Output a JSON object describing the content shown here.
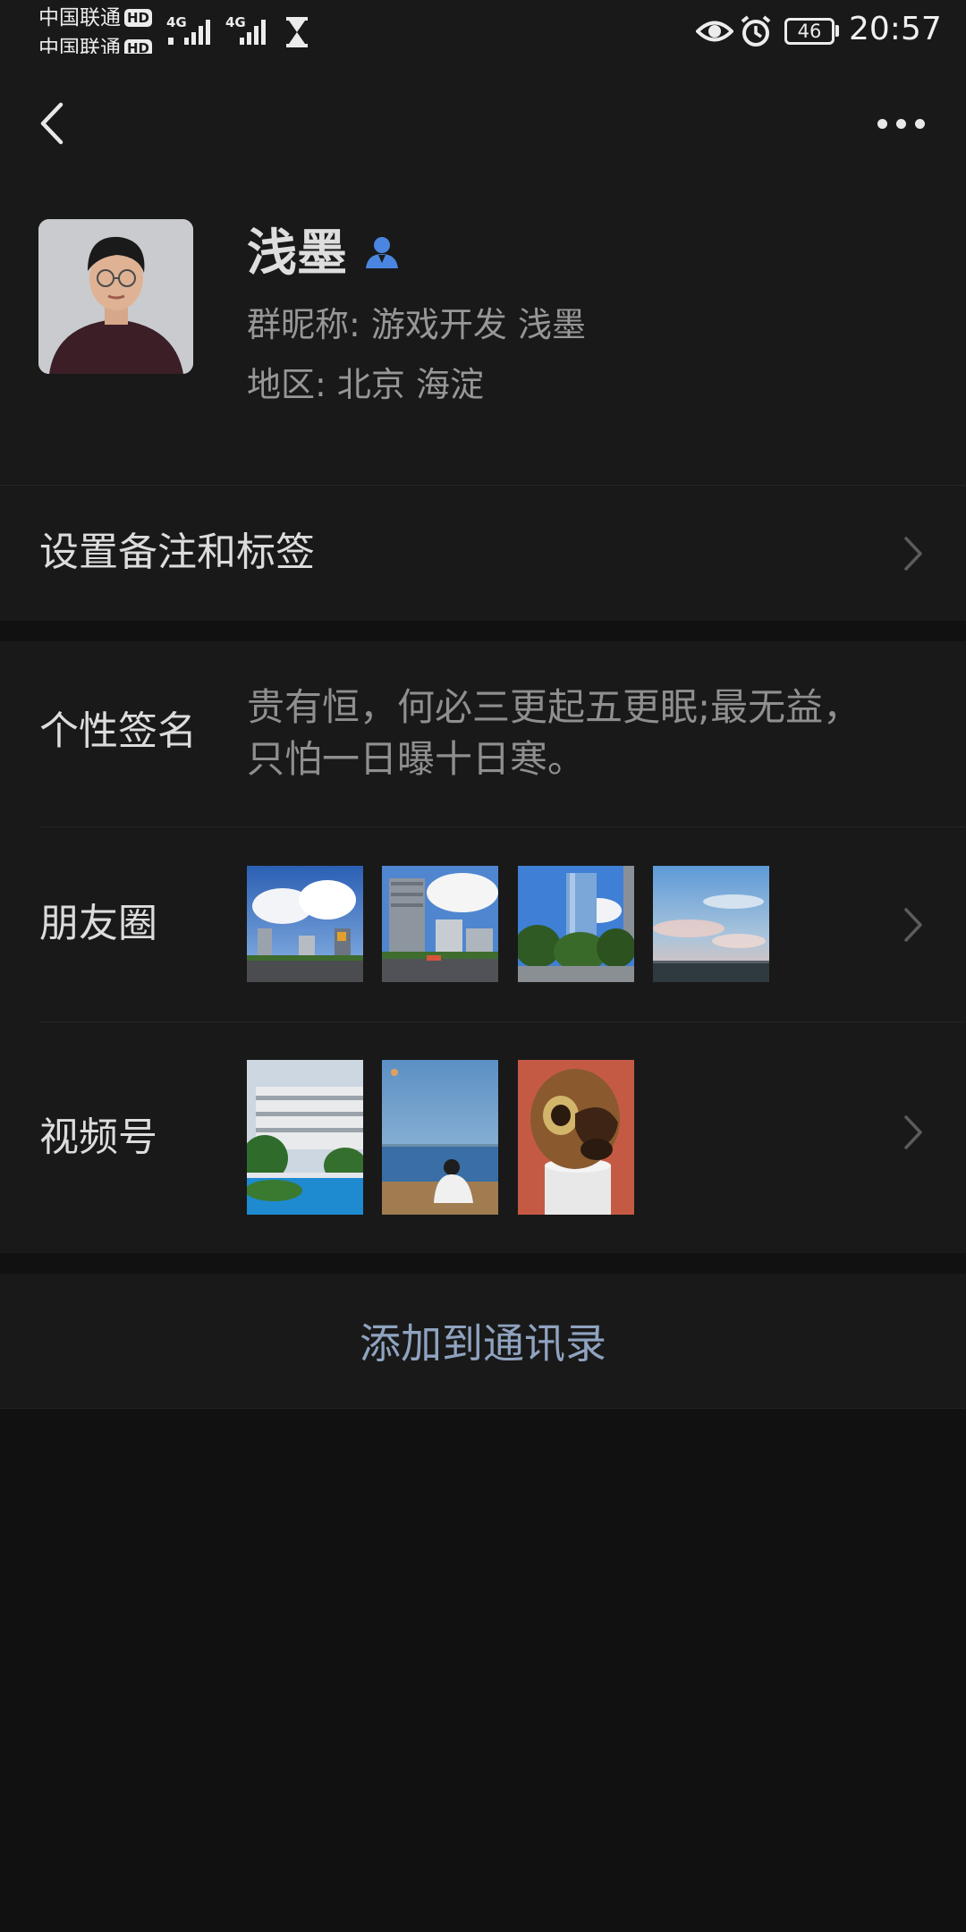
{
  "status_bar": {
    "carrier_1": "中国联通",
    "carrier_2": "中国联通",
    "hd_1": "HD",
    "hd_2": "HD",
    "signal_label_1": "4G",
    "signal_label_2": "4G",
    "battery": "46",
    "time": "20:57",
    "icons": [
      "eye-icon",
      "alarm-icon",
      "battery-icon",
      "hourglass-icon"
    ]
  },
  "nav": {
    "back_icon": "chevron-left-icon",
    "more_icon": "more-dots-icon"
  },
  "profile": {
    "name": "浅墨",
    "name_badge_icon": "contact-person-icon",
    "group_nickname": "群昵称:  游戏开发 浅墨",
    "region": "地区:  北京  海淀"
  },
  "rows": {
    "remark": "设置备注和标签",
    "signature_label": "个性签名",
    "signature_text": "贵有恒，何必三更起五更眠;最无益，\n只怕一日曝十日寒。",
    "moments_label": "朋友圈",
    "channels_label": "视频号"
  },
  "actions": {
    "add_contact": "添加到通讯录"
  },
  "colors": {
    "page_bg": "#111111",
    "card_bg": "#191919",
    "accent_link": "#8fa3c0",
    "badge_blue": "#4a86e0"
  }
}
